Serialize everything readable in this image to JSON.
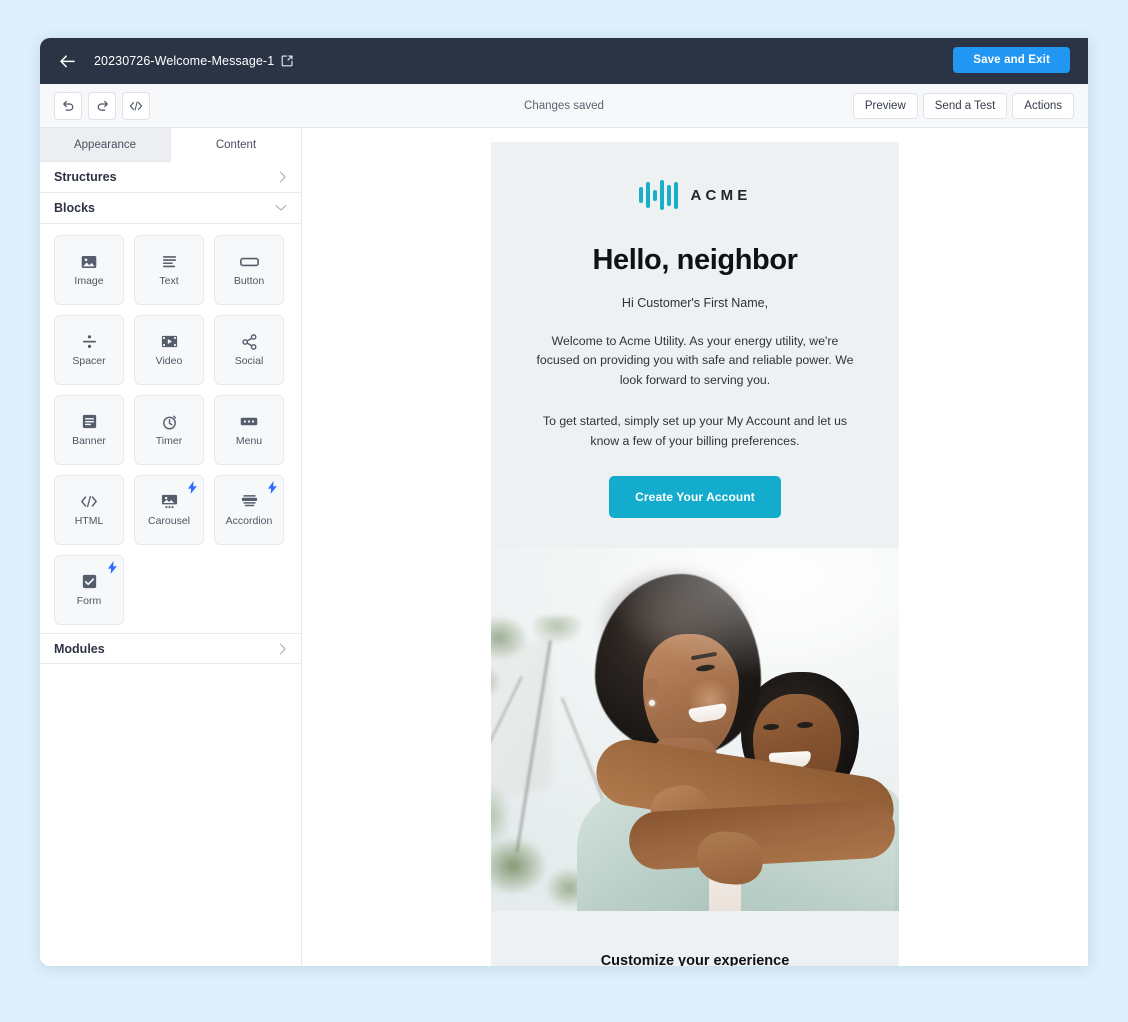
{
  "window": {
    "topbar": {
      "back_icon": "arrow-left-icon",
      "doc_title": "20230726-Welcome-Message-1",
      "edit_icon": "pencil-square-icon",
      "save_exit_label": "Save and Exit",
      "accent_blue": "#2196f3",
      "bar_bg": "#2b3445"
    },
    "toolbar": {
      "undo_icon": "undo-icon",
      "redo_icon": "redo-icon",
      "code_icon": "code-brackets-icon",
      "status": "Changes saved",
      "buttons": [
        {
          "label": "Preview"
        },
        {
          "label": "Send a Test"
        },
        {
          "label": "Actions"
        }
      ]
    }
  },
  "sidebar": {
    "tabs": [
      {
        "label": "Appearance",
        "active": false
      },
      {
        "label": "Content",
        "active": true
      }
    ],
    "sections": [
      {
        "label": "Structures",
        "state": "collapsed",
        "chevron": "chevron-right-icon"
      },
      {
        "label": "Blocks",
        "state": "expanded",
        "chevron": "chevron-down-icon"
      },
      {
        "label": "Modules",
        "state": "collapsed",
        "chevron": "chevron-right-icon"
      }
    ],
    "blocks": [
      {
        "label": "Image",
        "icon": "image-icon",
        "badge": false
      },
      {
        "label": "Text",
        "icon": "text-lines-icon",
        "badge": false
      },
      {
        "label": "Button",
        "icon": "button-icon",
        "badge": false
      },
      {
        "label": "Spacer",
        "icon": "spacer-icon",
        "badge": false
      },
      {
        "label": "Video",
        "icon": "video-icon",
        "badge": false
      },
      {
        "label": "Social",
        "icon": "share-icon",
        "badge": false
      },
      {
        "label": "Banner",
        "icon": "banner-icon",
        "badge": false
      },
      {
        "label": "Timer",
        "icon": "timer-icon",
        "badge": false
      },
      {
        "label": "Menu",
        "icon": "menu-icon",
        "badge": false
      },
      {
        "label": "HTML",
        "icon": "code-brackets-icon",
        "badge": false
      },
      {
        "label": "Carousel",
        "icon": "carousel-icon",
        "badge": true
      },
      {
        "label": "Accordion",
        "icon": "accordion-icon",
        "badge": true
      },
      {
        "label": "Form",
        "icon": "form-checkbox-icon",
        "badge": true
      }
    ],
    "badge_icon": "lightning-bolt-icon",
    "badge_color": "#2f6bff"
  },
  "email": {
    "brand": {
      "wordmark": "ACME",
      "logo_icon": "acme-soundbars-logo",
      "logo_color": "#1aaec8"
    },
    "headline": "Hello, neighbor",
    "greeting": "Hi Customer's First Name,",
    "paragraph_1": "Welcome to Acme Utility. As your energy utility, we're focused on providing you with safe and reliable power. We look forward to serving you.",
    "paragraph_2": "To get started, simply set up your My Account and let us know a few of your billing preferences.",
    "cta_label": "Create Your Account",
    "cta_color": "#14accd",
    "hero_image_alt": "woman and child embracing outdoors",
    "closing_heading": "Customize your experience",
    "body_bg": "#eef1f2"
  },
  "page": {
    "background": "#ddeffb"
  }
}
